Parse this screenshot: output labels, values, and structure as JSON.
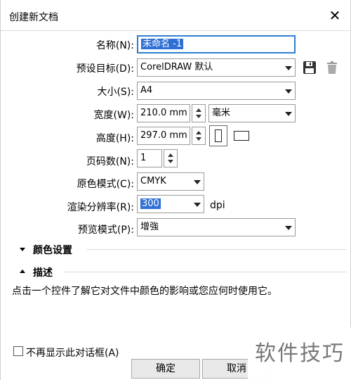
{
  "window": {
    "title": "创建新文档",
    "close_glyph": "✕"
  },
  "fields": {
    "name": {
      "label": "名称(N):",
      "value": "未命名 -1"
    },
    "preset": {
      "label": "预设目标(D):",
      "value": "CorelDRAW 默认"
    },
    "size": {
      "label": "大小(S):",
      "value": "A4"
    },
    "width": {
      "label": "宽度(W):",
      "value": "210.0 mm",
      "unit": "毫米"
    },
    "height": {
      "label": "高度(H):",
      "value": "297.0 mm"
    },
    "pages": {
      "label": "页码数(N):",
      "value": "1"
    },
    "color_mode": {
      "label": "原色模式(C):",
      "value": "CMYK"
    },
    "resolution": {
      "label": "渲染分辨率(R):",
      "value": "300",
      "unit": "dpi"
    },
    "preview": {
      "label": "预览模式(P):",
      "value": "增強"
    }
  },
  "sections": {
    "color_settings": "颜色设置",
    "description": "描述"
  },
  "description_text": "点击一个控件了解它对文件中颜色的影响或您应何时使用它。",
  "footer": {
    "dont_show": "不再显示此对话框(A)",
    "ok": "确定",
    "cancel": "取消"
  },
  "watermark": "软件技巧",
  "icons": {
    "save_preset": "save-icon",
    "delete_preset": "trash-icon",
    "portrait": "portrait-icon",
    "landscape": "landscape-icon"
  },
  "colors": {
    "focus_border": "#2f7fcf",
    "selection": "#2f6fd6"
  }
}
